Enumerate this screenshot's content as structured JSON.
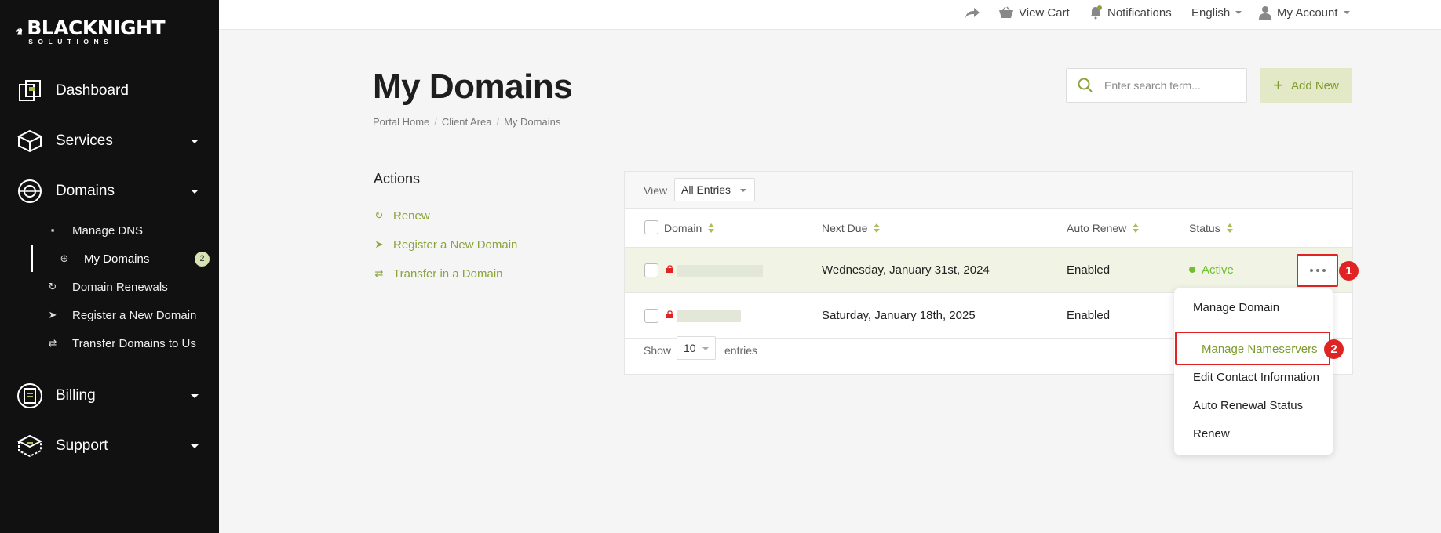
{
  "brand": {
    "name": "BLACKNIGHT",
    "sub": "SOLUTIONS"
  },
  "sidebar": {
    "items": [
      {
        "label": "Dashboard"
      },
      {
        "label": "Services"
      },
      {
        "label": "Domains"
      },
      {
        "label": "Billing"
      },
      {
        "label": "Support"
      }
    ],
    "domains_sub": [
      {
        "label": "Manage DNS"
      },
      {
        "label": "My Domains",
        "badge": "2"
      },
      {
        "label": "Domain Renewals"
      },
      {
        "label": "Register a New Domain"
      },
      {
        "label": "Transfer Domains to Us"
      }
    ]
  },
  "topbar": {
    "view_cart": "View Cart",
    "notifications": "Notifications",
    "language": "English",
    "account": "My Account"
  },
  "page": {
    "title": "My Domains",
    "breadcrumb": [
      "Portal Home",
      "Client Area",
      "My Domains"
    ],
    "search_placeholder": "Enter search term...",
    "add_new": "Add New"
  },
  "actions": {
    "title": "Actions",
    "links": [
      "Renew",
      "Register a New Domain",
      "Transfer in a Domain"
    ]
  },
  "table": {
    "view_label": "View",
    "view_value": "All Entries",
    "headers": [
      "Domain",
      "Next Due",
      "Auto Renew",
      "Status"
    ],
    "rows": [
      {
        "next_due": "Wednesday, January 31st, 2024",
        "auto_renew": "Enabled",
        "status": "Active"
      },
      {
        "next_due": "Saturday, January 18th, 2025",
        "auto_renew": "Enabled",
        "status": ""
      }
    ],
    "show_label": "Show",
    "show_value": "10",
    "entries_label": "entries"
  },
  "dropdown": {
    "items": [
      "Manage Domain",
      "Manage Nameservers",
      "Edit Contact Information",
      "Auto Renewal Status",
      "Renew"
    ]
  },
  "annotations": {
    "badge1": "1",
    "badge2": "2"
  },
  "colors": {
    "accent": "#8aa33a",
    "active": "#6fbf2f",
    "highlight": "#e02424",
    "sidebar": "#111111"
  }
}
